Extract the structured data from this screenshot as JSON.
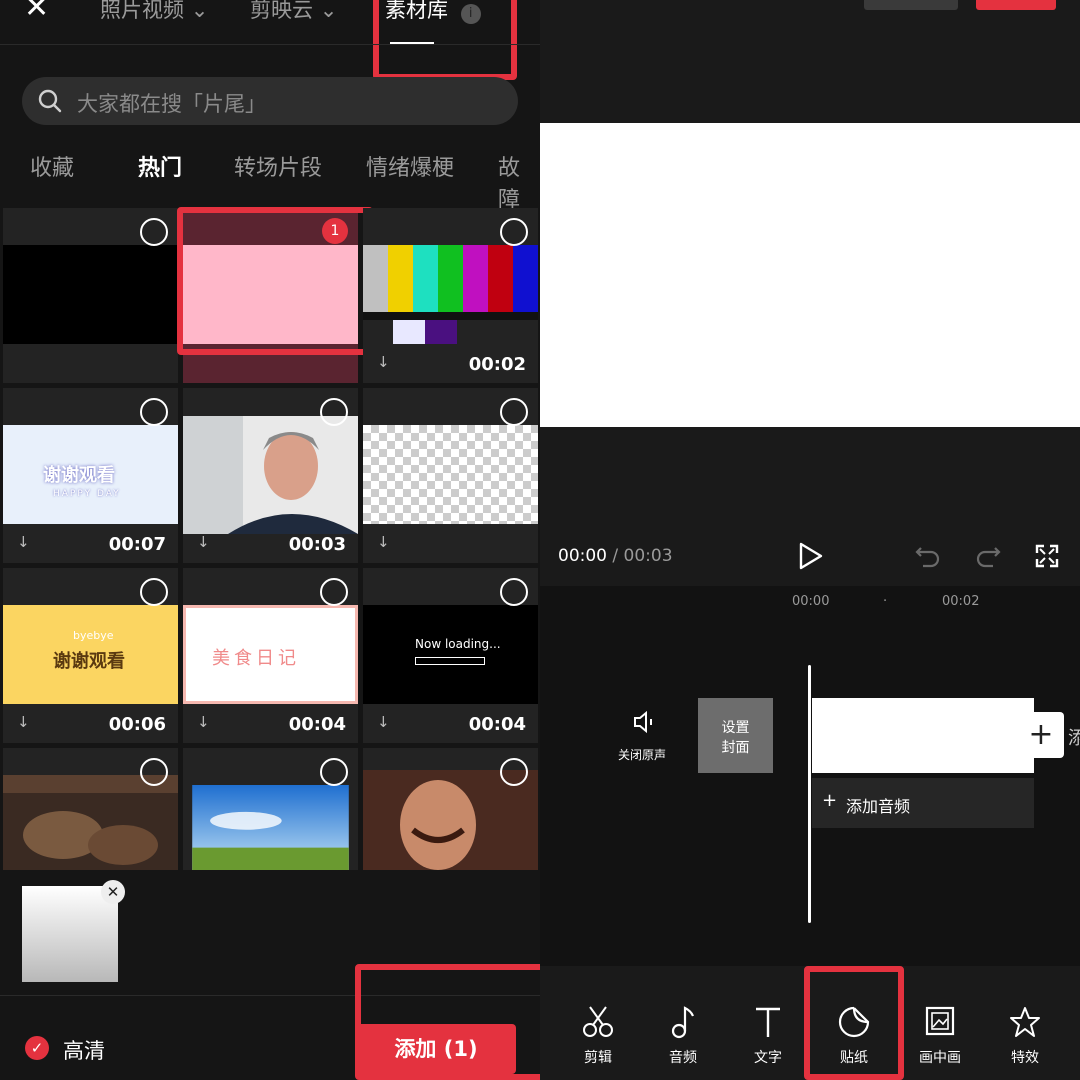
{
  "media_picker": {
    "close_label": "✕",
    "tabs": [
      {
        "label": "照片视频",
        "arrow": "⌄"
      },
      {
        "label": "剪映云",
        "arrow": "⌄"
      },
      {
        "label": "素材库",
        "badge": "i"
      }
    ],
    "search_placeholder": "大家都在搜「片尾」",
    "categories": [
      "收藏",
      "热门",
      "转场片段",
      "情绪爆梗",
      "故障"
    ],
    "active_category": "热门",
    "grid": [
      {
        "name": "black",
        "duration": ""
      },
      {
        "name": "pink",
        "duration": "",
        "selected_number": "1"
      },
      {
        "name": "color-bars",
        "duration": "00:02"
      },
      {
        "name": "thanks-happy-day",
        "duration": "00:07",
        "text": "谢谢观看",
        "subtext": "HAPPY DAY"
      },
      {
        "name": "man-meme",
        "duration": "00:03"
      },
      {
        "name": "transparent",
        "duration": ""
      },
      {
        "name": "byebye-thanks",
        "duration": "00:06",
        "text": "谢谢观看",
        "subtext": "byebye"
      },
      {
        "name": "food-diary",
        "duration": "00:04",
        "text": "美食日记"
      },
      {
        "name": "now-loading",
        "duration": "00:04",
        "text": "Now loading..."
      },
      {
        "name": "ducks",
        "duration": ""
      },
      {
        "name": "sky-field",
        "duration": ""
      },
      {
        "name": "laughing-man",
        "duration": ""
      }
    ],
    "download_icon": "↓",
    "selected_remove": "✕",
    "hd_label": "高清",
    "add_button": "添加 (1)"
  },
  "editor": {
    "time_current": "00:00",
    "time_separator": " / ",
    "time_total": "00:03",
    "ruler": [
      "00:00",
      "·",
      "00:02"
    ],
    "mute_label": "关闭原声",
    "cover_label_1": "设置",
    "cover_label_2": "封面",
    "add_audio": "添加音频",
    "add_clip_symbol": "+",
    "edge_text": "添",
    "toolbar": [
      {
        "label": "剪辑",
        "icon": "scissors-icon"
      },
      {
        "label": "音频",
        "icon": "music-note-icon"
      },
      {
        "label": "文字",
        "icon": "text-icon"
      },
      {
        "label": "贴纸",
        "icon": "sticker-icon"
      },
      {
        "label": "画中画",
        "icon": "picture-in-picture-icon"
      },
      {
        "label": "特效",
        "icon": "effects-star-icon"
      }
    ]
  },
  "colors": {
    "accent_red": "#e4323f",
    "pink_clip": "#ffb7c9",
    "maroon": "#5a2430"
  }
}
